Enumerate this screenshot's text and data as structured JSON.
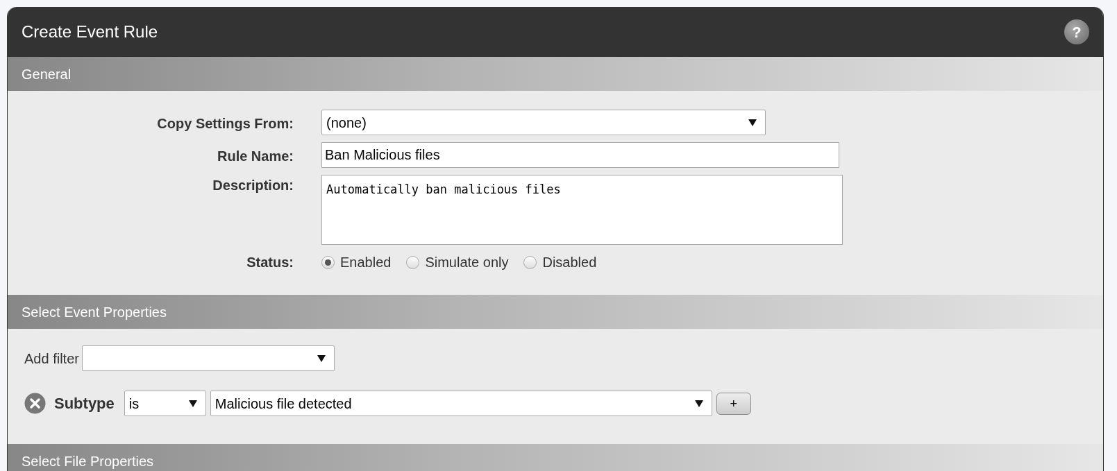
{
  "window": {
    "title": "Create Event Rule",
    "help_button": {
      "label": "?"
    }
  },
  "sections": [
    {
      "kind": "general",
      "title": "General",
      "fields": [
        {
          "kind": "select",
          "label": "Copy Settings From:",
          "value": "(none)"
        },
        {
          "kind": "text",
          "label": "Rule Name:",
          "value": "Ban Malicious files"
        },
        {
          "kind": "textarea",
          "label": "Description:",
          "value": "Automatically ban malicious files"
        },
        {
          "kind": "radio",
          "label": "Status:",
          "options": [
            {
              "label": "Enabled",
              "selected": true
            },
            {
              "label": "Simulate only",
              "selected": false
            },
            {
              "label": "Disabled",
              "selected": false
            }
          ]
        }
      ]
    },
    {
      "kind": "filters",
      "title": "Select Event Properties",
      "add_filter": {
        "label": "Add filter"
      },
      "filters": [
        {
          "name": "Subtype",
          "operator": "is",
          "value": "Malicious file detected",
          "add_label": "+"
        }
      ]
    },
    {
      "kind": "cut",
      "title": "Select File Properties"
    }
  ]
}
